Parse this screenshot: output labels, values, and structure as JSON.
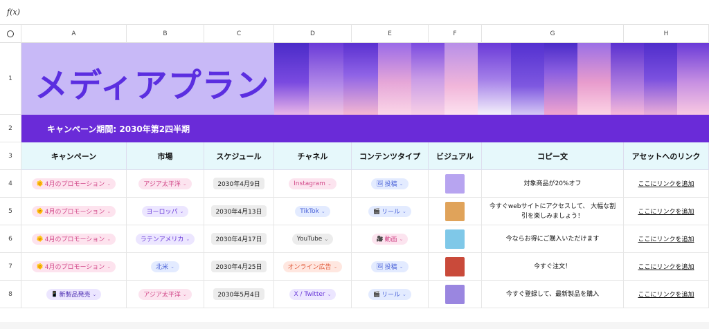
{
  "formula_bar": {
    "fx_label": "f(x)"
  },
  "columns": [
    "A",
    "B",
    "C",
    "D",
    "E",
    "F",
    "G",
    "H"
  ],
  "rows": [
    "1",
    "2",
    "3",
    "4",
    "5",
    "6",
    "7",
    "8"
  ],
  "banner": {
    "title": "メディアプラン"
  },
  "period": {
    "text": "キャンペーン期間: 2030年第2四半期"
  },
  "headers": [
    "キャンペーン",
    "市場",
    "スケジュール",
    "チャネル",
    "コンテンツタイプ",
    "ビジュアル",
    "コピー文",
    "アセットへのリンク"
  ],
  "table_rows": [
    {
      "campaign": "4月のプロモーション",
      "campaign_icon": "🌞",
      "campaign_style": "camp",
      "market": "アジア太平洋",
      "market_style": "pink",
      "date": "2030年4月9日",
      "channel": "Instagram",
      "channel_style": "pink",
      "content": "投稿",
      "content_icon": "🖼",
      "content_style": "blue",
      "visual_color": "#b7a4f0",
      "copy": "対象商品が20%オフ",
      "link": "ここにリンクを追加"
    },
    {
      "campaign": "4月のプロモーション",
      "campaign_icon": "🌞",
      "campaign_style": "camp",
      "market": "ヨーロッパ",
      "market_style": "purple",
      "date": "2030年4月13日",
      "channel": "TikTok",
      "channel_style": "blue",
      "content": "リール",
      "content_icon": "🎬",
      "content_style": "blue",
      "visual_color": "#e0a35a",
      "copy": "今すぐwebサイトにアクセスして、 大幅な割引を楽しみましょう！",
      "link": "ここにリンクを追加"
    },
    {
      "campaign": "4月のプロモーション",
      "campaign_icon": "🌞",
      "campaign_style": "camp",
      "market": "ラテンアメリカ",
      "market_style": "purple",
      "date": "2030年4月17日",
      "channel": "YouTube",
      "channel_style": "gray",
      "content": "動画",
      "content_icon": "🎥",
      "content_style": "pink",
      "visual_color": "#7fc8e8",
      "copy": "今ならお得にご購入いただけます",
      "link": "ここにリンクを追加"
    },
    {
      "campaign": "4月のプロモーション",
      "campaign_icon": "🌞",
      "campaign_style": "camp",
      "market": "北米",
      "market_style": "blue",
      "date": "2030年4月25日",
      "channel": "オンライン広告",
      "channel_style": "orange",
      "content": "投稿",
      "content_icon": "🖼",
      "content_style": "blue",
      "visual_color": "#c94a3a",
      "copy": "今すぐ注文！",
      "link": "ここにリンクを追加"
    },
    {
      "campaign": "新製品発売",
      "campaign_icon": "📱",
      "campaign_style": "launch",
      "market": "アジア太平洋",
      "market_style": "pink",
      "date": "2030年5月4日",
      "channel": "X / Twitter",
      "channel_style": "purple",
      "content": "リール",
      "content_icon": "🎬",
      "content_style": "blue",
      "visual_color": "#9a86e0",
      "copy": "今すぐ登録して、最新製品を購入",
      "link": "ここにリンクを追加"
    }
  ],
  "colors": {
    "banner_bg": "#c8b9f7",
    "banner_title": "#5b2ee0",
    "period_bar": "#6a2bd8",
    "header_bg": "#e6f8fb"
  }
}
